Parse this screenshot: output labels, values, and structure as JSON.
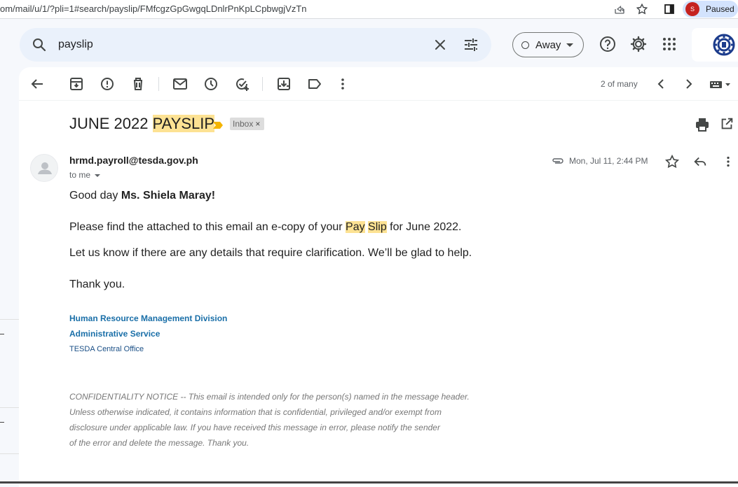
{
  "browser": {
    "url": "om/mail/u/1/?pli=1#search/payslip/FMfcgzGpGwgqLDnlrPnKpLCpbwgjVzTn",
    "profile_initial": "S",
    "profile_status": "Paused",
    "icons": [
      "share-icon",
      "star-icon",
      "sidebar-icon"
    ]
  },
  "header": {
    "search_value": "payslip",
    "status_label": "Away",
    "icons": [
      "search-icon",
      "close-icon",
      "tune-icon",
      "help-icon",
      "settings-icon",
      "apps-icon"
    ]
  },
  "toolbar": {
    "pager_text": "2 of many",
    "icons": [
      "back-icon",
      "archive-icon",
      "report-spam-icon",
      "delete-icon",
      "mark-unread-icon",
      "snooze-icon",
      "add-task-icon",
      "move-to-icon",
      "label-icon",
      "more-icon",
      "prev-icon",
      "next-icon",
      "keyboard-icon"
    ]
  },
  "email": {
    "subject_prefix": "JUNE 2022 ",
    "subject_highlight": "PAYSLIP",
    "label": "Inbox",
    "label_remove": "×",
    "sender": "hrmd.payroll@tesda.gov.ph",
    "to_line": "to me",
    "date": "Mon, Jul 11, 2:44 PM",
    "greeting_prefix": "Good day ",
    "greeting_name": "Ms. Shiela Maray!",
    "para1_prefix": "Please find the attached to this email an e-copy of your ",
    "para1_hl1": "Pay",
    "para1_space": " ",
    "para1_hl2": "Slip",
    "para1_suffix": " for June 2022.",
    "para2": "Let us know if there are any details that require clarification. We’ll be glad to help.",
    "closing": "Thank you.",
    "sig_line1": "Human Resource Management Division",
    "sig_line2": "Administrative Service",
    "sig_line3": "TESDA Central Office",
    "conf_line1": "CONFIDENTIALITY NOTICE -- This email is intended only for the person(s) named in the message header.",
    "conf_line2": "Unless otherwise indicated, it contains information that is confidential, privileged and/or exempt from",
    "conf_line3": "disclosure under applicable law. If you have received this message in error, please notify the sender",
    "conf_line4": "of the error and delete the message. Thank you."
  },
  "colors": {
    "highlight": "#fde293",
    "signature_blue": "#1a6fa8",
    "important_marker": "#f4b400",
    "profile_avatar": "#c5221f"
  }
}
